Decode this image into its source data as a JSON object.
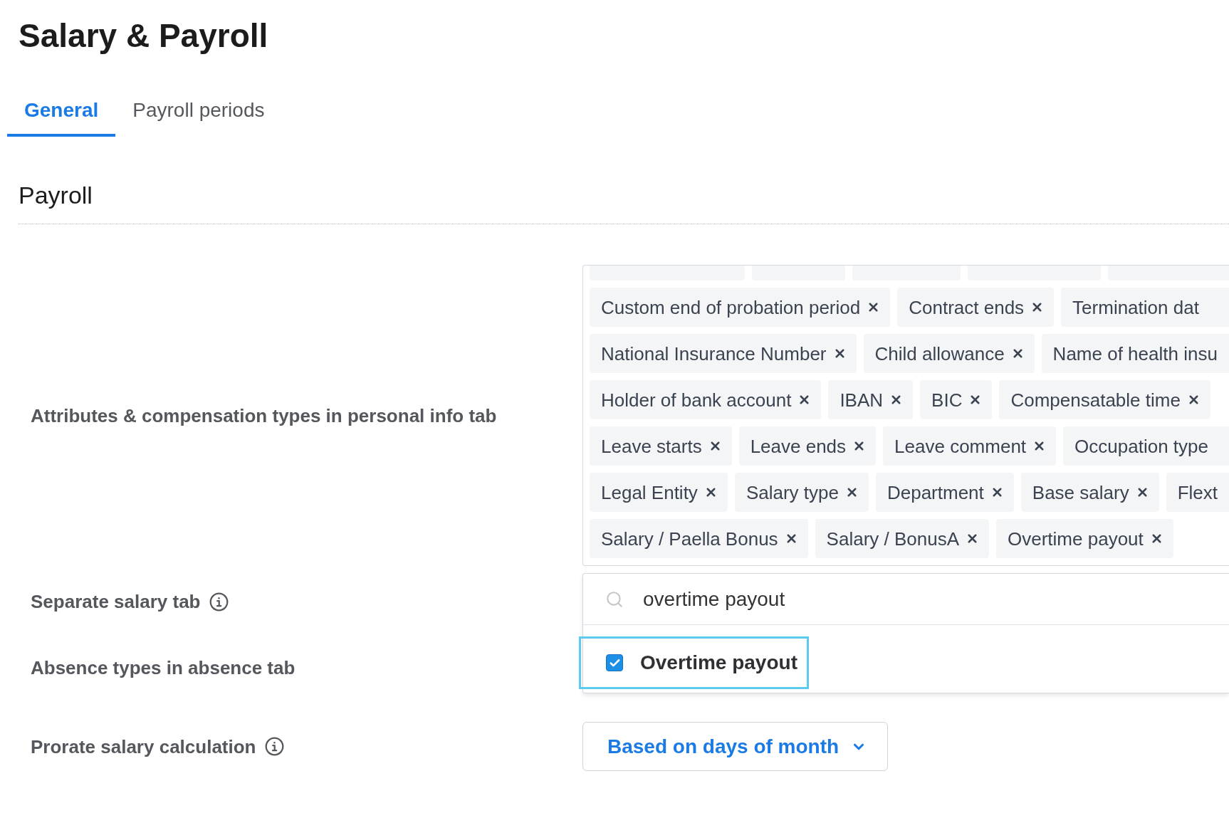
{
  "page": {
    "title": "Salary & Payroll"
  },
  "tabs": [
    {
      "label": "General",
      "selected": true
    },
    {
      "label": "Payroll periods",
      "selected": false
    }
  ],
  "section": {
    "title": "Payroll"
  },
  "attributes": {
    "label": "Attributes & compensation types in personal info tab",
    "tag_rows": [
      [
        {
          "label": "Custom end of probation period",
          "clipped": false
        },
        {
          "label": "Contract ends",
          "clipped": false
        },
        {
          "label": "Termination dat",
          "clipped": true
        }
      ],
      [
        {
          "label": "National Insurance Number",
          "clipped": false
        },
        {
          "label": "Child allowance",
          "clipped": false
        },
        {
          "label": "Name of health insu",
          "clipped": true
        }
      ],
      [
        {
          "label": "Holder of bank account",
          "clipped": false
        },
        {
          "label": "IBAN",
          "clipped": false
        },
        {
          "label": "BIC",
          "clipped": false
        },
        {
          "label": "Compensatable time",
          "clipped": false
        }
      ],
      [
        {
          "label": "Leave starts",
          "clipped": false
        },
        {
          "label": "Leave ends",
          "clipped": false
        },
        {
          "label": "Leave comment",
          "clipped": false
        },
        {
          "label": "Occupation type",
          "clipped": true
        }
      ],
      [
        {
          "label": "Legal Entity",
          "clipped": false
        },
        {
          "label": "Salary type",
          "clipped": false
        },
        {
          "label": "Department",
          "clipped": false
        },
        {
          "label": "Base salary",
          "clipped": false
        },
        {
          "label": "Flext",
          "clipped": true
        }
      ],
      [
        {
          "label": "Salary / Paella Bonus",
          "clipped": false
        },
        {
          "label": "Salary / BonusA",
          "clipped": false
        },
        {
          "label": "Overtime payout",
          "clipped": false
        }
      ]
    ],
    "dropdown": {
      "search_value": "overtime payout",
      "options": [
        {
          "label": "Overtime payout",
          "checked": true,
          "focused": true
        }
      ]
    }
  },
  "settings": [
    {
      "kind": "covered",
      "label": "Separate salary tab",
      "info": true
    },
    {
      "kind": "covered",
      "label": "Absence types in absence tab",
      "info": false
    },
    {
      "kind": "select",
      "label": "Prorate salary calculation",
      "info": true,
      "value": "Based on days of month"
    }
  ]
}
